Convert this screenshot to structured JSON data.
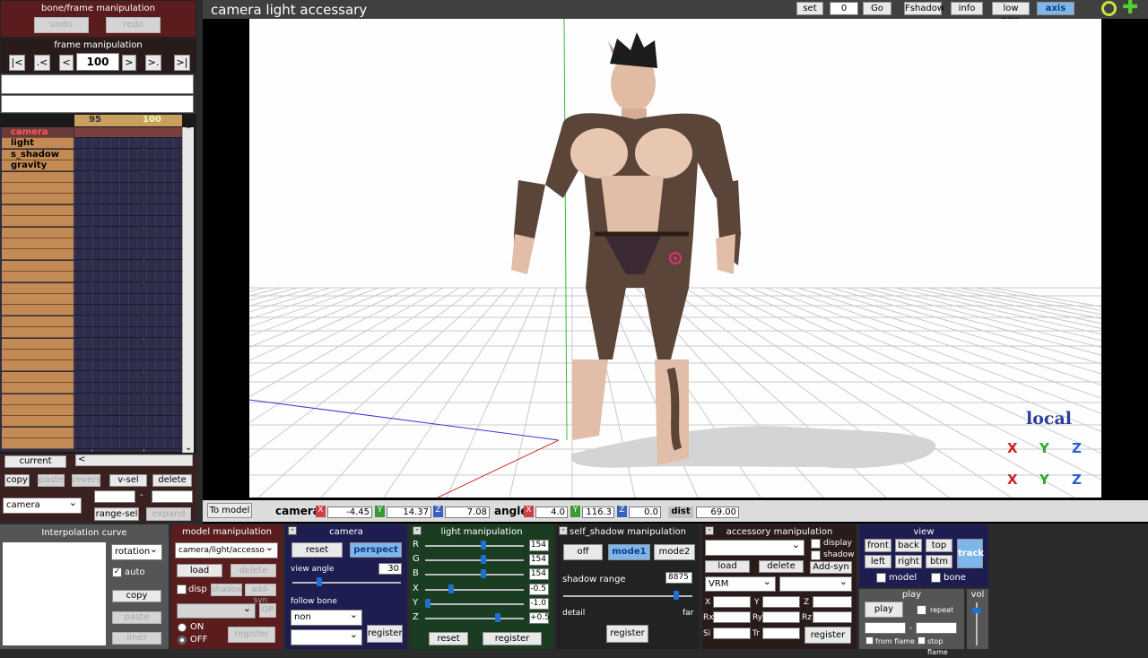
{
  "bone_frame": {
    "title": "bone/frame manipulation",
    "undo": "undo",
    "redo": "redo",
    "frame_title": "frame manipulation",
    "btn_first": "|<",
    "btn_prevkey": ".<",
    "btn_prev": "<",
    "frame": "100",
    "btn_next": ">",
    "btn_nextkey": ">.",
    "btn_last": ">|"
  },
  "timeline": {
    "tick_95": "95",
    "tick_100": "100",
    "rows": [
      "camera",
      "light",
      "s_shadow",
      "gravity"
    ],
    "current": "current",
    "copy": "copy",
    "paste": "paste",
    "revers": "revers",
    "vsel": "v-sel",
    "delete": "delete",
    "select": "camera",
    "range_dash": "-",
    "rangesel": "range-sel",
    "expand": "expand"
  },
  "viewport": {
    "title": "camera light accessary",
    "set": "set",
    "set_value": "0",
    "go": "Go",
    "fshadow": "Fshadow",
    "info": "info",
    "lowpow": "low pow",
    "axis": "axis",
    "local": "local",
    "gizmo_x": "X",
    "gizmo_y": "Y",
    "gizmo_z": "Z"
  },
  "status": {
    "to_model": "To model",
    "camera_label": "camera",
    "x": "X",
    "x_val": "-4.45",
    "y": "Y",
    "y_val": "14.37",
    "z": "Z",
    "z_val": "7.08",
    "angle_label": "angle",
    "ax_val": "4.0",
    "ay_val": "116.3",
    "az_val": "0.0",
    "dist_label": "dist",
    "dist_val": "69.00"
  },
  "interp": {
    "title": "Interpolation curve",
    "select": "rotation",
    "auto": "auto",
    "copy": "copy",
    "paste": "paste",
    "liner": "liner"
  },
  "model": {
    "title": "model manipulation",
    "select": "camera/light/accesso",
    "load": "load",
    "delete": "delete",
    "disp": "disp",
    "shadow": "shadow",
    "addsyn": "add-syn",
    "op": "OP",
    "on": "ON",
    "off": "OFF",
    "register": "register"
  },
  "camera": {
    "title": "camera",
    "reset": "reset",
    "perspect": "perspect",
    "view_angle": "view angle",
    "view_angle_val": "30",
    "follow_bone": "follow bone",
    "follow_sel": "non",
    "register": "register"
  },
  "light": {
    "title": "light manipulation",
    "r": "R",
    "g": "G",
    "b": "B",
    "x": "X",
    "y": "Y",
    "z": "Z",
    "r_val": "154",
    "g_val": "154",
    "b_val": "154",
    "x_val": "-0.5",
    "y_val": "-1.0",
    "z_val": "+0.5",
    "reset": "reset",
    "register": "register",
    "r_level": 0.6,
    "g_level": 0.6,
    "b_level": 0.6,
    "x_level": 0.25,
    "y_level": 0.0,
    "z_level": 0.75
  },
  "shadow": {
    "title": "self_shadow manipulation",
    "off": "off",
    "mode1": "mode1",
    "mode2": "mode2",
    "range": "shadow range",
    "range_val": "8875",
    "detail": "detail",
    "far": "far",
    "register": "register",
    "range_level": 0.89
  },
  "accessory": {
    "title": "accessory manipulation",
    "display": "display",
    "shadow": "shadow",
    "load": "load",
    "delete": "delete",
    "addsyn": "Add-syn",
    "vrm": "VRM",
    "x": "X",
    "y": "Y",
    "z": "Z",
    "rx": "Rx",
    "ry": "Ry",
    "rz": "Rz",
    "si": "Si",
    "tr": "Tr",
    "register": "register"
  },
  "view": {
    "title": "view",
    "front": "front",
    "back": "back",
    "top": "top",
    "left": "left",
    "right": "right",
    "btm": "btm",
    "track": "track",
    "model": "model",
    "bone": "bone"
  },
  "play": {
    "title": "play",
    "play": "play",
    "repeat": "repeat",
    "dash": "-",
    "from_frame": "from flame",
    "stop_frame": "stop flame"
  },
  "vol": {
    "title": "vol",
    "level": 0.85
  },
  "colors": {
    "accent": "#1e6fd0",
    "panel_red": "#5a1c1c",
    "panel_blue": "#1d1d52",
    "panel_green": "#1a3d22"
  }
}
